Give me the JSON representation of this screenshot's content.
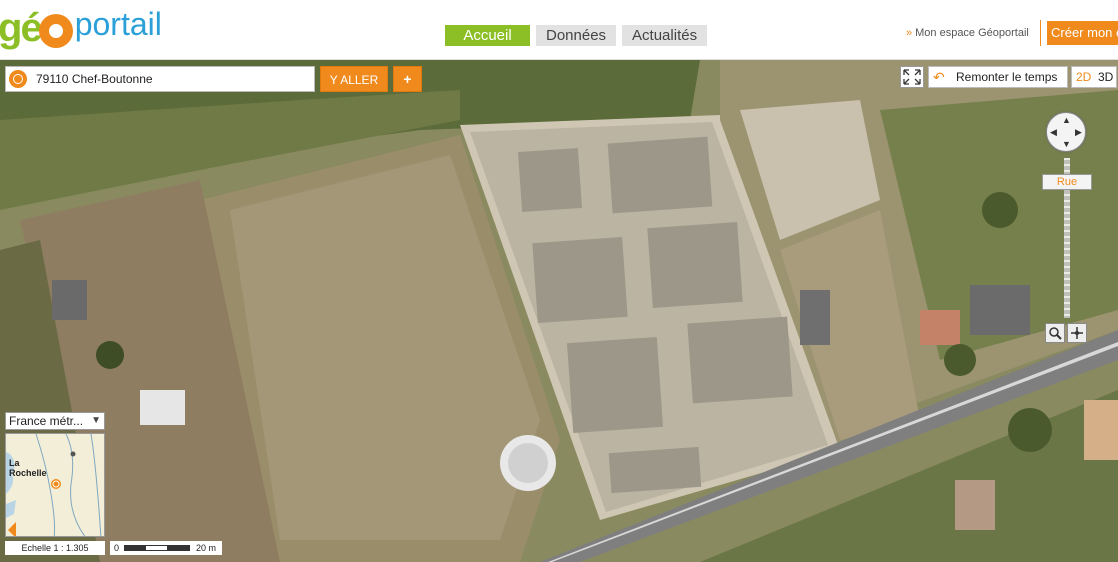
{
  "header": {
    "logo": {
      "ge": "gé",
      "portail": "portail"
    },
    "tabs": [
      {
        "label": "Accueil",
        "active": true
      },
      {
        "label": "Données",
        "active": false
      },
      {
        "label": "Actualités",
        "active": false
      }
    ],
    "espace_link": "Mon espace Géoportail",
    "create_button": "Créer mon e"
  },
  "search": {
    "value": "79110 Chef-Boutonne",
    "go_label": "Y ALLER",
    "plus_label": "+"
  },
  "controls": {
    "remonter_label": "Remonter le temps",
    "mode_2d": "2D",
    "mode_3d": "3D",
    "zoom_level_label": "Rue"
  },
  "overview": {
    "region": "France métr...",
    "city_line1": "La",
    "city_line2": "Rochelle"
  },
  "scale": {
    "echelle": "Echelle 1 : 1.305",
    "bar_zero": "0",
    "bar_end": "20 m"
  },
  "colors": {
    "accent": "#f08a1c",
    "active_tab": "#8cbf26",
    "logo_blue": "#2a9fd8"
  }
}
